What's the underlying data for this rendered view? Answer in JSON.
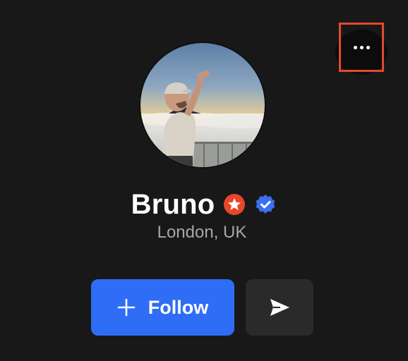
{
  "profile": {
    "name": "Bruno",
    "location": "London, UK",
    "avatar_description": "avatar-photo"
  },
  "badges": [
    {
      "icon": "star-badge-icon",
      "color": "#e8472a"
    },
    {
      "icon": "verified-badge-icon",
      "color": "#3b6ef0"
    }
  ],
  "actions": {
    "follow_label": "Follow",
    "follow_icon": "plus-icon",
    "message_icon": "send-icon",
    "more_icon": "more-dots-icon"
  },
  "colors": {
    "background": "#181818",
    "accent": "#2f6df6",
    "secondary_button": "#2a2a2a",
    "highlight": "#e24a2b",
    "text_primary": "#ffffff",
    "text_secondary": "#a7a7a7"
  }
}
